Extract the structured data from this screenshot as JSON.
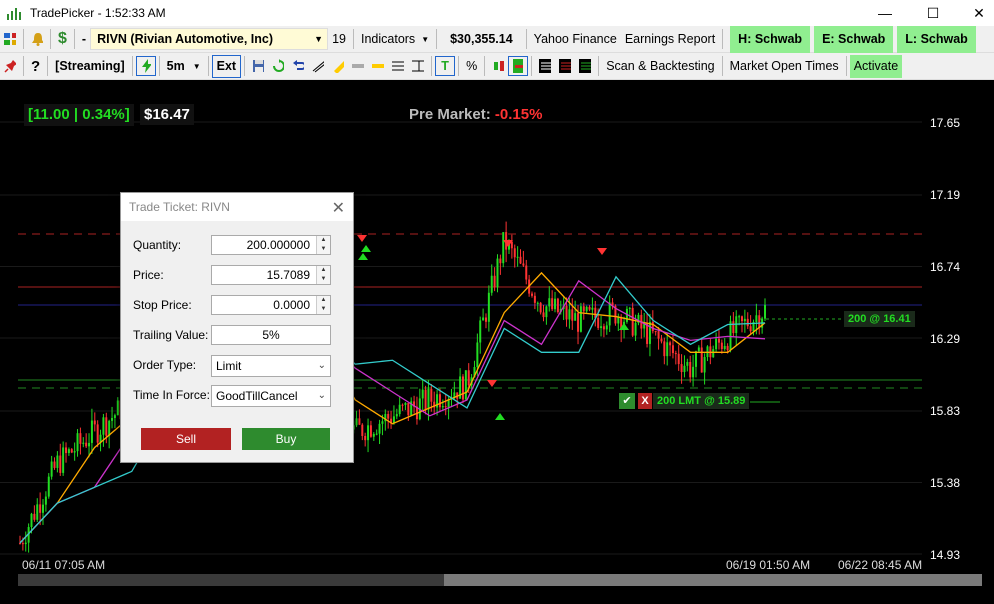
{
  "window": {
    "title": "TradePicker - 1:52:33 AM"
  },
  "toolbar1": {
    "symbol": "RIVN (Rivian Automotive, Inc)",
    "dash": "-",
    "count": "19",
    "indicators": "Indicators",
    "balance": "$30,355.14",
    "yahoo": "Yahoo Finance",
    "earnings": "Earnings Report",
    "h_schwab": "H: Schwab",
    "e_schwab": "E: Schwab",
    "l_schwab": "L: Schwab"
  },
  "toolbar2": {
    "streaming": "[Streaming]",
    "interval": "5m",
    "ext": "Ext",
    "t_btn": "T",
    "percent": "%",
    "scan": "Scan & Backtesting",
    "market_open": "Market Open Times",
    "activate": "Activate"
  },
  "chart": {
    "change": "[11.00 | 0.34%]",
    "price": "$16.47",
    "premarket_label": "Pre Market: ",
    "premarket_value": "-0.15%",
    "price_ticks": [
      "17.65",
      "17.19",
      "16.74",
      "16.29",
      "15.83",
      "15.38",
      "14.93"
    ],
    "dates": [
      "06/11 07:05 AM",
      "06/19 01:50 AM",
      "06/22 08:45 AM"
    ],
    "position_tag": "200 @ 16.41",
    "order_tag": "200 LMT @ 15.89",
    "order_x": "X",
    "colors": {
      "up": "#22dd22",
      "down": "#ff3333",
      "cyan": "#33cccc",
      "magenta": "#cc33cc",
      "orange": "#ffaa00"
    }
  },
  "chart_data": {
    "type": "line",
    "title": "",
    "ylim": [
      14.93,
      17.65
    ],
    "y_ticks": [
      17.65,
      17.19,
      16.74,
      16.29,
      15.83,
      15.38,
      14.93
    ],
    "x_labels": [
      "06/11 07:05 AM",
      "06/19 01:50 AM",
      "06/22 08:45 AM"
    ],
    "series": [
      {
        "values": [
          15.0,
          15.5,
          15.7,
          15.9,
          16.2,
          16.6,
          16.55,
          16.5,
          16.1,
          15.7,
          15.8,
          15.9,
          16.0,
          16.9,
          16.5,
          16.4,
          16.45,
          16.3,
          16.1,
          16.3,
          16.47
        ]
      }
    ]
  },
  "dialog": {
    "title": "Trade Ticket: RIVN",
    "quantity_label": "Quantity:",
    "quantity": "200.000000",
    "price_label": "Price:",
    "price": "15.7089",
    "stop_label": "Stop Price:",
    "stop": "0.0000",
    "trailing_label": "Trailing Value:",
    "trailing": "5%",
    "order_type_label": "Order Type:",
    "order_type": "Limit",
    "tif_label": "Time In Force:",
    "tif": "GoodTillCancel",
    "sell": "Sell",
    "buy": "Buy"
  }
}
